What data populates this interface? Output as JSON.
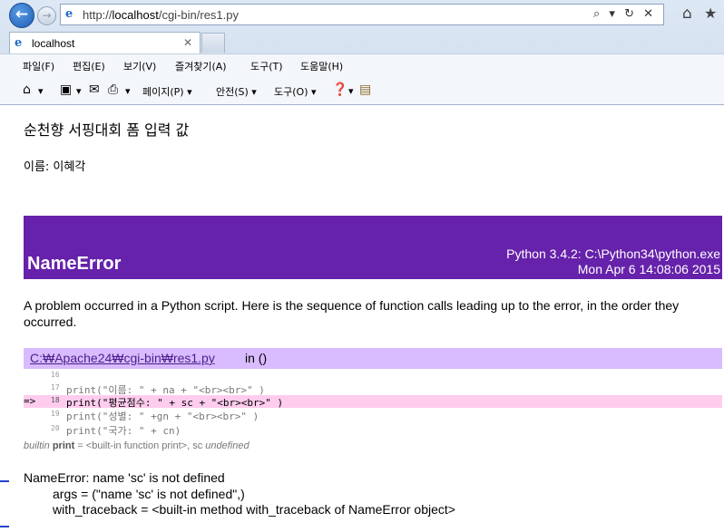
{
  "browser": {
    "url_prefix": "http://",
    "url_host": "localhost",
    "url_path": "/cgi-bin/res1.py",
    "address_tools": "⌕ ▾ ↻ ✕",
    "tab_title": "localhost",
    "tab_close": "✕"
  },
  "menu": {
    "file": "파일(F)",
    "edit": "편집(E)",
    "view": "보기(V)",
    "favorites": "즐겨찾기(A)",
    "tools": "도구(T)",
    "help": "도움말(H)"
  },
  "command_bar": {
    "page": "페이지(P) ▾",
    "safety": "안전(S) ▾",
    "tools": "도구(O) ▾"
  },
  "page": {
    "title": "순천향 서핑대회 폼 입력 값",
    "name_line": "이름: 이혜각"
  },
  "error": {
    "type": "NameError",
    "python_info": "Python 3.4.2: C:\\Python34\\python.exe",
    "timestamp": "Mon Apr 6 14:08:06 2015",
    "intro": "A problem occurred in a Python script. Here is the sequence of function calls leading up to the error, in the order they occurred.",
    "frame_file": "C:₩Apache24₩cgi-bin₩res1.py",
    "frame_in": "in ()",
    "code_lines": [
      {
        "marker": "",
        "num": "16",
        "src": ""
      },
      {
        "marker": "",
        "num": "17",
        "src": "print(\"이름: \" + na + \"<br><br>\" )"
      },
      {
        "marker": "=>",
        "num": "18",
        "src": "print(\"평균점수: \" + sc + \"<br><br>\" )"
      },
      {
        "marker": "",
        "num": "19",
        "src": "print(\"성별: \" +gn + \"<br><br>\" )"
      },
      {
        "marker": "",
        "num": "20",
        "src": "print(\"국가: \" + cn)"
      }
    ],
    "vars_prefix": "builtin",
    "vars_name": "print",
    "vars_mid": "= <built-in function print>, sc",
    "vars_undefined": "undefined",
    "exception_type": "NameError",
    "exception_msg": ": name 'sc' is not defined",
    "args_line": "args = (\"name 'sc' is not defined\",)",
    "traceback_line": "with_traceback = <built-in method with_traceback of NameError object>"
  },
  "colors": {
    "banner": "#6622aa",
    "frame_header": "#d9bbff",
    "highlight_line": "#ffccee"
  }
}
